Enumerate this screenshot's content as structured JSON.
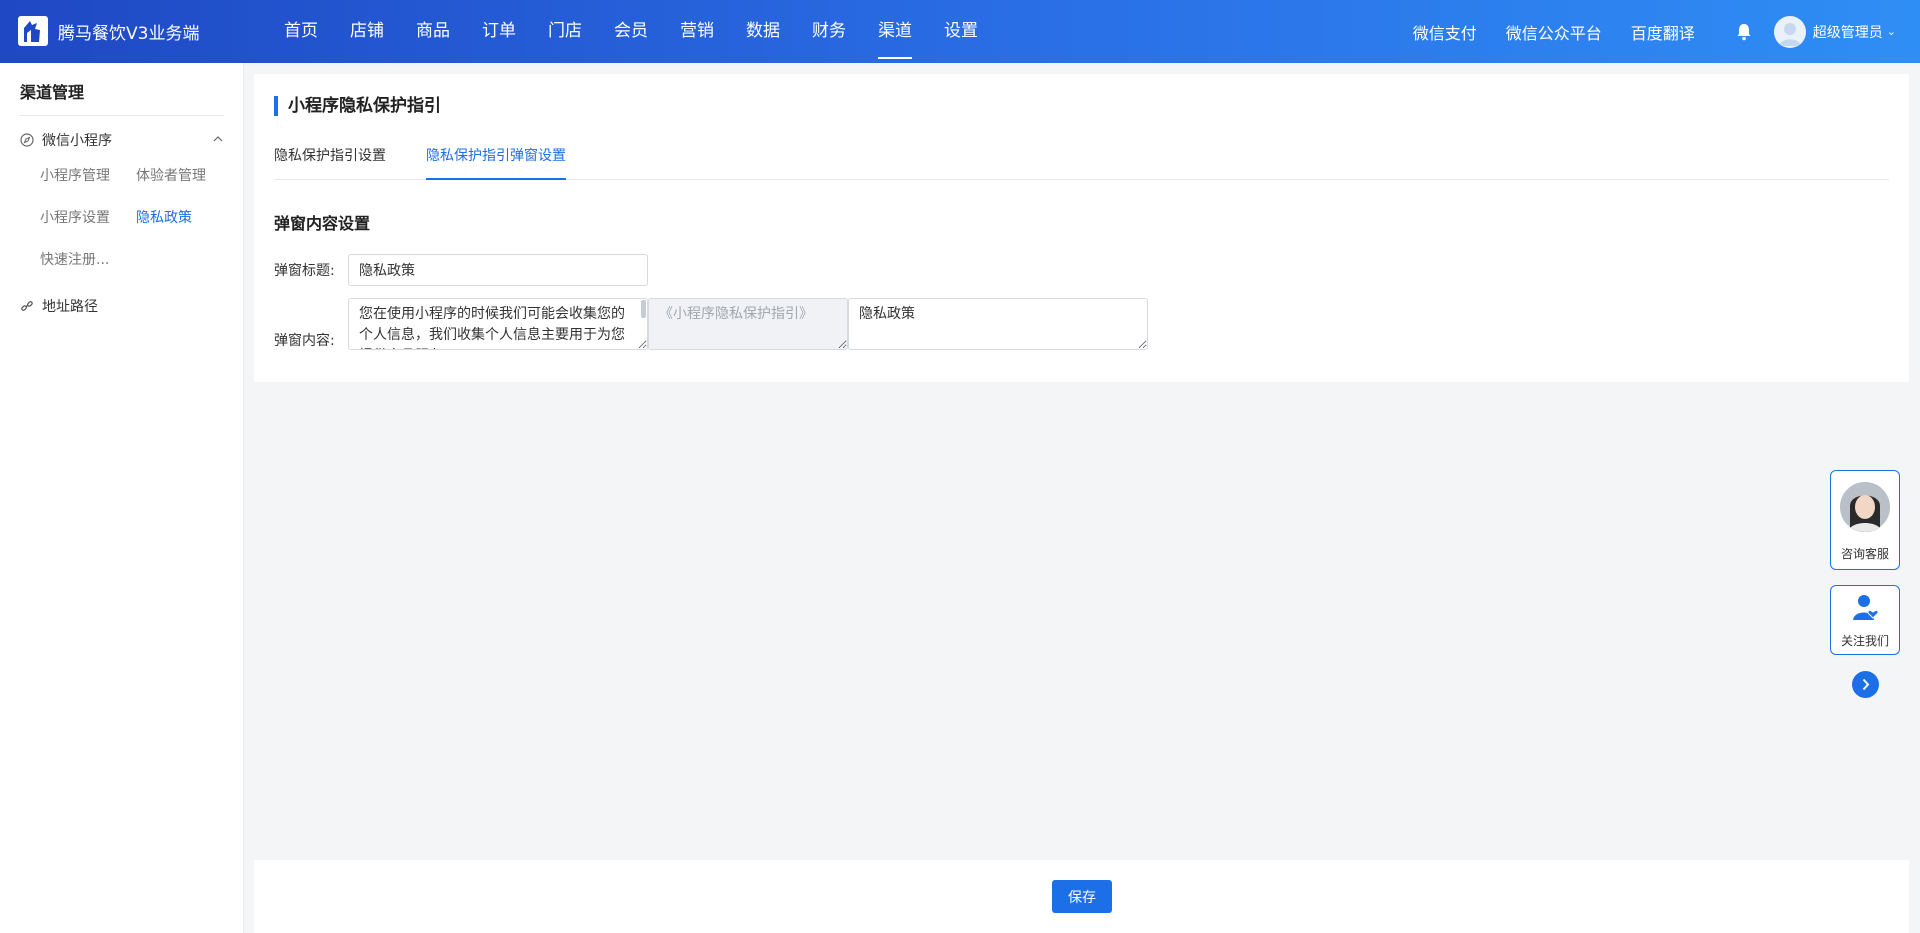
{
  "app": {
    "title": "腾马餐饮V3业务端"
  },
  "nav": {
    "items": [
      "首页",
      "店铺",
      "商品",
      "订单",
      "门店",
      "会员",
      "营销",
      "数据",
      "财务",
      "渠道",
      "设置"
    ],
    "active": "渠道"
  },
  "top_links": [
    "微信支付",
    "微信公众平台",
    "百度翻译"
  ],
  "user": {
    "name": "超级管理员"
  },
  "sidebar": {
    "title": "渠道管理",
    "group": "微信小程序",
    "sub": [
      "小程序管理",
      "体验者管理",
      "小程序设置",
      "隐私政策",
      "快速注册..."
    ],
    "active_sub": "隐私政策",
    "group2": "地址路径"
  },
  "main": {
    "title": "小程序隐私保护指引",
    "tabs": [
      "隐私保护指引设置",
      "隐私保护指引弹窗设置"
    ],
    "active_tab": "隐私保护指引弹窗设置",
    "section_title": "弹窗内容设置",
    "form": {
      "title_label": "弹窗标题:",
      "title_value": "隐私政策",
      "content_label": "弹窗内容:",
      "content_part1": "您在使用小程序的时候我们可能会收集您的个人信息，我们收集个人信息主要用于为您提供产品服务",
      "content_part2": "《小程序隐私保护指引》",
      "content_part3": "隐私政策"
    }
  },
  "float": {
    "kefu_label": "咨询客服",
    "follow_label": "关注我们"
  },
  "footer": {
    "save_label": "保存"
  },
  "colors": {
    "accent": "#1d6fe8",
    "topbar_start": "#1f48c4",
    "topbar_end": "#2f8ef5"
  }
}
